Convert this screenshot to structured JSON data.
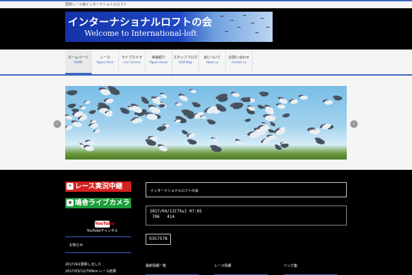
{
  "topbar": {
    "text": "国際レース鳩インターナショナルロフト"
  },
  "logo": {
    "title_jp": "インターナショナルロフトの会",
    "title_en": "Welcome to International-loft"
  },
  "nav": [
    {
      "jp": "ホームページ",
      "en": "HOME",
      "active": true
    },
    {
      "jp": "レース",
      "en": "Pigeon Race",
      "active": false
    },
    {
      "jp": "ライブカメラ",
      "en": "Live Camera",
      "active": false
    },
    {
      "jp": "鳩舎紹介",
      "en": "Pigeon House",
      "active": false
    },
    {
      "jp": "スタッフブログ",
      "en": "Staff Blog",
      "active": false
    },
    {
      "jp": "会について",
      "en": "About us",
      "active": false
    },
    {
      "jp": "お問い合わせ",
      "en": "Contact us",
      "active": false
    }
  ],
  "slider": {
    "prev": "‹",
    "next": "›"
  },
  "sidebar": {
    "race_label": "レース実況中継",
    "camera_label": "鳩舎ライブカメラ",
    "youtube_logo": "YouTube",
    "youtube_text": "YouTubeチャンネル",
    "box_title": "お知らせ",
    "news": [
      "2017/4/2更新しました",
      "2017/03/12/700km レース結果"
    ]
  },
  "main": {
    "panel_title": "インターナショナルロフトの会",
    "date_line": "2017/04/13[Thu] 07:05",
    "info_line": " 706   414",
    "counter": "0357578"
  },
  "footer": {
    "heads": [
      "最新情報一覧",
      "レース情報",
      "リンク集"
    ]
  },
  "colors": {
    "accent": "#3a68c0",
    "race": "#d42020",
    "camera": "#1d9e3a"
  }
}
